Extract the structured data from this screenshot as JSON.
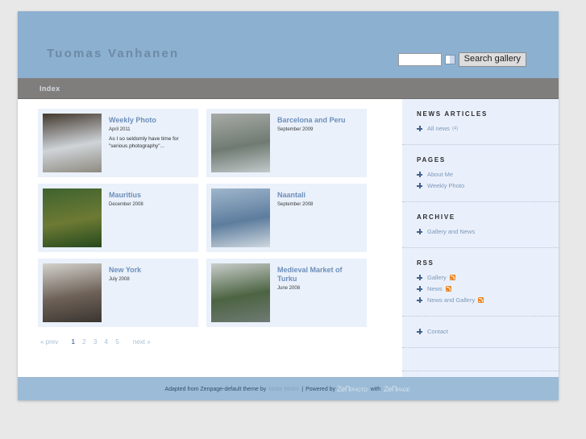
{
  "header": {
    "site_title": "Tuomas Vanhanen",
    "search": {
      "input_value": "",
      "input_placeholder": "",
      "select_icon": "dropdown-icon",
      "button_label": "Search gallery"
    }
  },
  "nav": {
    "items": [
      {
        "label": "Index"
      }
    ]
  },
  "content": {
    "cards": [
      {
        "title": "Weekly Photo",
        "date": "April 2011",
        "desc": "As I so seldomly have time for \"serious photography\"...",
        "thumb_colors": [
          "#43382e",
          "#cfd4d8",
          "#8e8a80"
        ]
      },
      {
        "title": "Barcelona and Peru",
        "date": "September 2009",
        "desc": "",
        "thumb_colors": [
          "#a8aaa6",
          "#6f7b72",
          "#c3c9cb"
        ]
      },
      {
        "title": "Mauritius",
        "date": "December 2008",
        "desc": "",
        "thumb_colors": [
          "#3f6330",
          "#6d7a33",
          "#24491e"
        ]
      },
      {
        "title": "Naantali",
        "date": "September 2008",
        "desc": "",
        "thumb_colors": [
          "#9fb6cb",
          "#5d7d9e",
          "#cfd8de"
        ]
      },
      {
        "title": "New York",
        "date": "July 2008",
        "desc": "",
        "thumb_colors": [
          "#d4d2cd",
          "#6e6258",
          "#3a3430"
        ]
      },
      {
        "title": "Medieval Market of Turku",
        "date": "June 2008",
        "desc": "",
        "thumb_colors": [
          "#c9cdcb",
          "#4c6442",
          "#6f7a74"
        ]
      }
    ],
    "pagination": {
      "prev_label": "« prev",
      "pages": [
        "1",
        "2",
        "3",
        "4",
        "5"
      ],
      "current": "1",
      "next_label": "next »"
    }
  },
  "sidebar": {
    "blocks": [
      {
        "heading": "NEWS ARTICLES",
        "links": [
          {
            "label": "All news",
            "count": "(4)",
            "rss": false
          }
        ]
      },
      {
        "heading": "PAGES",
        "links": [
          {
            "label": "About Me",
            "count": "",
            "rss": false
          },
          {
            "label": "Weekly Photo",
            "count": "",
            "rss": false
          }
        ]
      },
      {
        "heading": "ARCHIVE",
        "links": [
          {
            "label": "Gallery and News",
            "count": "",
            "rss": false
          }
        ]
      },
      {
        "heading": "RSS",
        "links": [
          {
            "label": "Gallery",
            "count": "",
            "rss": true
          },
          {
            "label": "News",
            "count": "",
            "rss": true
          },
          {
            "label": "News and Gallery",
            "count": "",
            "rss": true
          }
        ]
      },
      {
        "heading": "",
        "links": [
          {
            "label": "Contact",
            "count": "",
            "rss": false
          }
        ]
      }
    ]
  },
  "footer": {
    "text_1": "Adapted from Zenpage-default theme by",
    "author": "Malte Müller",
    "separator": "|",
    "text_2": "Powered by",
    "logo_1_big": "ZеП",
    "logo_1_small": "PHOTO",
    "text_3": "with",
    "logo_2_big": "ZеП",
    "logo_2_small": "PAGE"
  },
  "colors": {
    "header_blue": "#8cb0d0",
    "nav_gray": "#807e7d",
    "card_blue": "#eaf1fb",
    "sidebar_blue": "#eaf0fb",
    "footer_blue": "#9cbbd6",
    "link_blue": "#7b98bb",
    "rss_orange": "#ec8523"
  }
}
